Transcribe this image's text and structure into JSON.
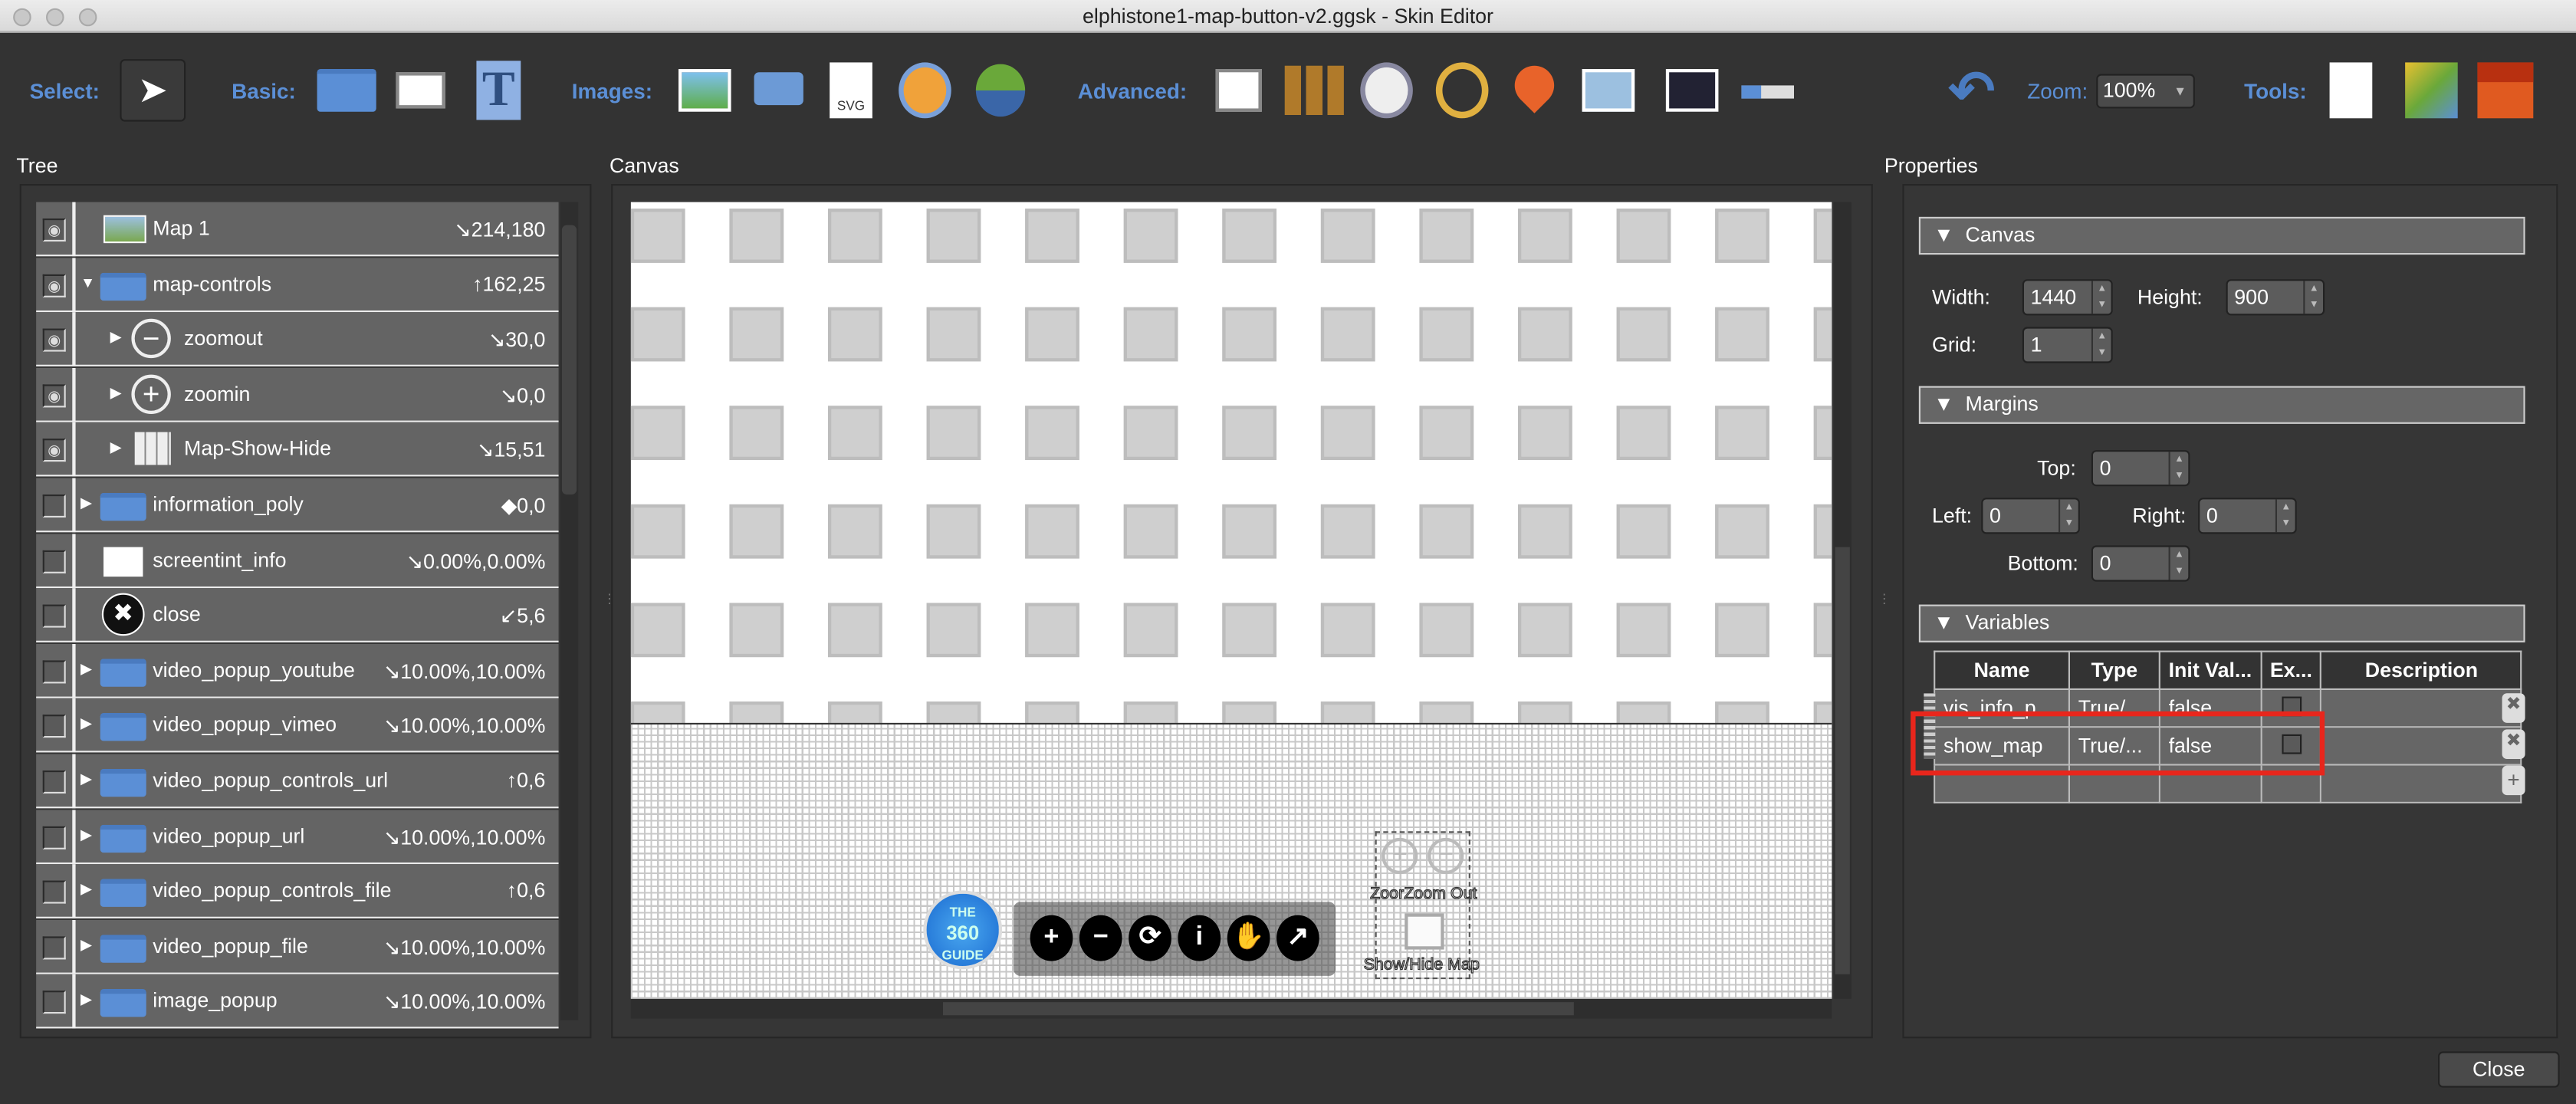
{
  "window": {
    "title": "elphistone1-map-button-v2.ggsk - Skin Editor"
  },
  "toolbar": {
    "select_label": "Select:",
    "basic_label": "Basic:",
    "images_label": "Images:",
    "advanced_label": "Advanced:",
    "zoom_label": "Zoom:",
    "zoom_value": "100%",
    "tools_label": "Tools:",
    "basic_icons": [
      "folder-icon",
      "rectangle-icon",
      "text-icon"
    ],
    "image_icons": [
      "image-icon",
      "image-button-icon",
      "svg-icon",
      "panorama-icon",
      "map-icon"
    ],
    "advanced_icons": [
      "cloner-icon",
      "grid-icon",
      "dial-icon",
      "crosshair-icon",
      "map-pin-icon",
      "map-tile-icon",
      "video-icon",
      "slider-icon"
    ],
    "tools_icons": [
      "find-icon",
      "color-palette-icon",
      "toolbox-icon"
    ]
  },
  "tree": {
    "title": "Tree",
    "rows": [
      {
        "label": "Map 1",
        "value": "↘214,180",
        "visible": true,
        "icon": "map-image-icon",
        "indent": 0,
        "expander": ""
      },
      {
        "label": "map-controls",
        "value": "↑162,25",
        "visible": true,
        "icon": "folder-icon",
        "indent": 0,
        "expander": "▼"
      },
      {
        "label": "zoomout",
        "value": "↘30,0",
        "visible": true,
        "icon": "zoom-out-icon",
        "indent": 1,
        "expander": "▶"
      },
      {
        "label": "zoomin",
        "value": "↘0,0",
        "visible": true,
        "icon": "zoom-in-icon",
        "indent": 1,
        "expander": "▶"
      },
      {
        "label": "Map-Show-Hide",
        "value": "↘15,51",
        "visible": true,
        "icon": "folded-map-icon",
        "indent": 1,
        "expander": "▶"
      },
      {
        "label": "information_poly",
        "value": "◆0,0",
        "visible": false,
        "icon": "folder-icon",
        "indent": 0,
        "expander": "▶"
      },
      {
        "label": "screentint_info",
        "value": "↘0.00%,0.00%",
        "visible": false,
        "icon": "rectangle-icon",
        "indent": 0,
        "expander": ""
      },
      {
        "label": "close",
        "value": "↙5,6",
        "visible": false,
        "icon": "close-icon",
        "indent": 0,
        "expander": ""
      },
      {
        "label": "video_popup_youtube",
        "value": "↘10.00%,10.00%",
        "visible": false,
        "icon": "folder-icon",
        "indent": 0,
        "expander": "▶"
      },
      {
        "label": "video_popup_vimeo",
        "value": "↘10.00%,10.00%",
        "visible": false,
        "icon": "folder-icon",
        "indent": 0,
        "expander": "▶"
      },
      {
        "label": "video_popup_controls_url",
        "value": "↑0,6",
        "visible": false,
        "icon": "folder-icon",
        "indent": 0,
        "expander": "▶"
      },
      {
        "label": "video_popup_url",
        "value": "↘10.00%,10.00%",
        "visible": false,
        "icon": "folder-icon",
        "indent": 0,
        "expander": "▶"
      },
      {
        "label": "video_popup_controls_file",
        "value": "↑0,6",
        "visible": false,
        "icon": "folder-icon",
        "indent": 0,
        "expander": "▶"
      },
      {
        "label": "video_popup_file",
        "value": "↘10.00%,10.00%",
        "visible": false,
        "icon": "folder-icon",
        "indent": 0,
        "expander": "▶"
      },
      {
        "label": "image_popup",
        "value": "↘10.00%,10.00%",
        "visible": false,
        "icon": "folder-icon",
        "indent": 0,
        "expander": "▶"
      }
    ]
  },
  "canvas": {
    "title": "Canvas",
    "logo_text": [
      "THE",
      "360",
      "GUIDE"
    ],
    "zoom_labels": "ZoorZoom Out",
    "map_label": "Show/Hide Map",
    "controls": [
      "+",
      "−",
      "⟳",
      "i",
      "✋",
      "↗"
    ]
  },
  "properties": {
    "title": "Properties",
    "canvas_section": "Canvas",
    "width_label": "Width:",
    "width": "1440",
    "height_label": "Height:",
    "height": "900",
    "grid_label": "Grid:",
    "grid": "1",
    "margins_section": "Margins",
    "top_label": "Top:",
    "top": "0",
    "left_label": "Left:",
    "left": "0",
    "right_label": "Right:",
    "right": "0",
    "bottom_label": "Bottom:",
    "bottom": "0",
    "variables_section": "Variables",
    "var_headers": [
      "Name",
      "Type",
      "Init Val...",
      "Ex...",
      "Description"
    ],
    "variables": [
      {
        "name": "vis_info_p",
        "type": "True/...",
        "init": "false"
      },
      {
        "name": "show_map",
        "type": "True/...",
        "init": "false"
      }
    ],
    "highlight_color": "#e8261c"
  },
  "footer": {
    "close_label": "Close"
  }
}
